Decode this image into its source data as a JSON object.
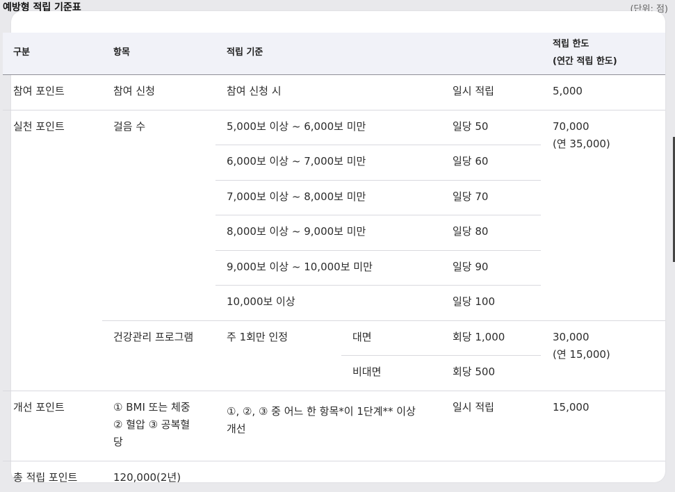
{
  "title": "예방형 적립 기준표",
  "unit": "(단위: 점)",
  "header": {
    "category": "구분",
    "item": "항목",
    "criteria": "적립 기준",
    "limit_line1": "적립 한도",
    "limit_line2": "(연간 적립 한도)"
  },
  "rows": {
    "participation": {
      "category": "참여 포인트",
      "item": "참여 신청",
      "criteria": "참여 신청 시",
      "points": "일시 적립",
      "limit": "5,000"
    },
    "practice": {
      "category": "실천 포인트",
      "steps": {
        "item": "걸음 수",
        "limit_line1": "70,000",
        "limit_line2": "(연 35,000)",
        "tiers": [
          {
            "criteria": "5,000보 이상 ~ 6,000보 미만",
            "points": "일당 50"
          },
          {
            "criteria": "6,000보 이상 ~ 7,000보 미만",
            "points": "일당 60"
          },
          {
            "criteria": "7,000보 이상 ~ 8,000보 미만",
            "points": "일당 70"
          },
          {
            "criteria": "8,000보 이상 ~ 9,000보 미만",
            "points": "일당 80"
          },
          {
            "criteria": "9,000보 이상 ~ 10,000보 미만",
            "points": "일당 90"
          },
          {
            "criteria": "10,000보 이상",
            "points": "일당 100"
          }
        ]
      },
      "program": {
        "item": "건강관리 프로그램",
        "criteria": "주 1회만 인정",
        "limit_line1": "30,000",
        "limit_line2": "(연 15,000)",
        "modes": [
          {
            "mode": "대면",
            "points": "회당 1,000"
          },
          {
            "mode": "비대면",
            "points": "회당 500"
          }
        ]
      }
    },
    "improvement": {
      "category": "개선 포인트",
      "item_line1": "① BMI 또는 체중",
      "item_line2": "② 혈압 ③ 공복혈",
      "item_line3": "당",
      "criteria_line1": "①, ②, ③ 중 어느 한 항목*이 1단계** 이상",
      "criteria_line2": "개선",
      "points": "일시 적립",
      "limit": "15,000"
    },
    "total": {
      "category": "총 적립 포인트",
      "value": "120,000(2년)"
    }
  }
}
